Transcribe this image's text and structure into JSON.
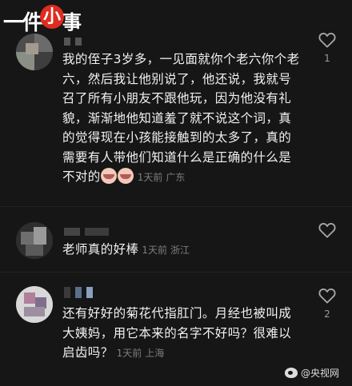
{
  "brand": {
    "logo_left": "一件",
    "logo_badge": "小",
    "logo_right": "事"
  },
  "comments": [
    {
      "text": "我的侄子3岁多，一见面就你个老六你个老六，然后我让他别说了，他还说，我就号召了所有小朋友不跟他玩，因为他没有礼貌，渐渐地他知道羞了就不说这个词，真的觉得现在小孩能接触到的太多了，真的需要有人带他们知道什么是正确的什么是不对的",
      "emojis": [
        "grin-emoji",
        "grin-emoji"
      ],
      "time": "1天前",
      "location": "广东",
      "likes": "1"
    },
    {
      "text": "老师真的好棒",
      "time": "1天前",
      "location": "浙江",
      "likes": ""
    },
    {
      "text": "还有好好的菊花代指肛门。月经也被叫成大姨妈，用它本来的名字不好吗？很难以启齿吗？",
      "time": "1天前",
      "location": "上海",
      "likes": "2"
    }
  ],
  "watermark": "@央视网",
  "colors": {
    "background": "#161616",
    "text": "#f2f2f2",
    "meta": "#7d7d7d",
    "brand_red": "#e02b20"
  },
  "icons": {
    "like": "heart-outline-icon",
    "watermark": "weibo-icon"
  }
}
